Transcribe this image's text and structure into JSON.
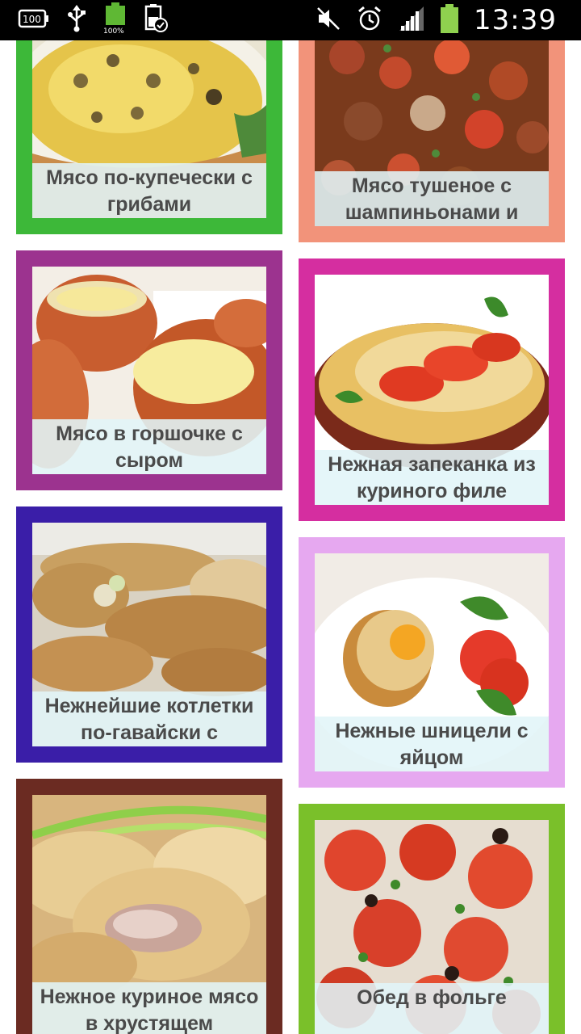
{
  "status_bar": {
    "time": "13:39",
    "battery_label": "100%",
    "left_icons": [
      "sd-card-icon",
      "usb-icon",
      "battery-full-icon",
      "battery-check-icon"
    ],
    "right_icons": [
      "mute-icon",
      "alarm-icon",
      "signal-icon",
      "battery-icon"
    ]
  },
  "recipes": [
    {
      "title": "Мясо по-купечески с грибами",
      "border_color": "#3db839"
    },
    {
      "title": "Мясо тушеное с шампиньонами и",
      "border_color": "#f2937a"
    },
    {
      "title": "Мясо в горшочке с сыром",
      "border_color": "#9c338f"
    },
    {
      "title": "Нежная запеканка из куриного филе",
      "border_color": "#d52ea0"
    },
    {
      "title": "Нежнейшие котлетки по-гавайски с",
      "border_color": "#3a1ea8"
    },
    {
      "title": "Нежные шницели с яйцом",
      "border_color": "#e6a8f0"
    },
    {
      "title": "Нежное куриное мясо в хрустящем",
      "border_color": "#6b2b22"
    },
    {
      "title": "Обед в фольге",
      "border_color": "#7ac02a"
    }
  ]
}
